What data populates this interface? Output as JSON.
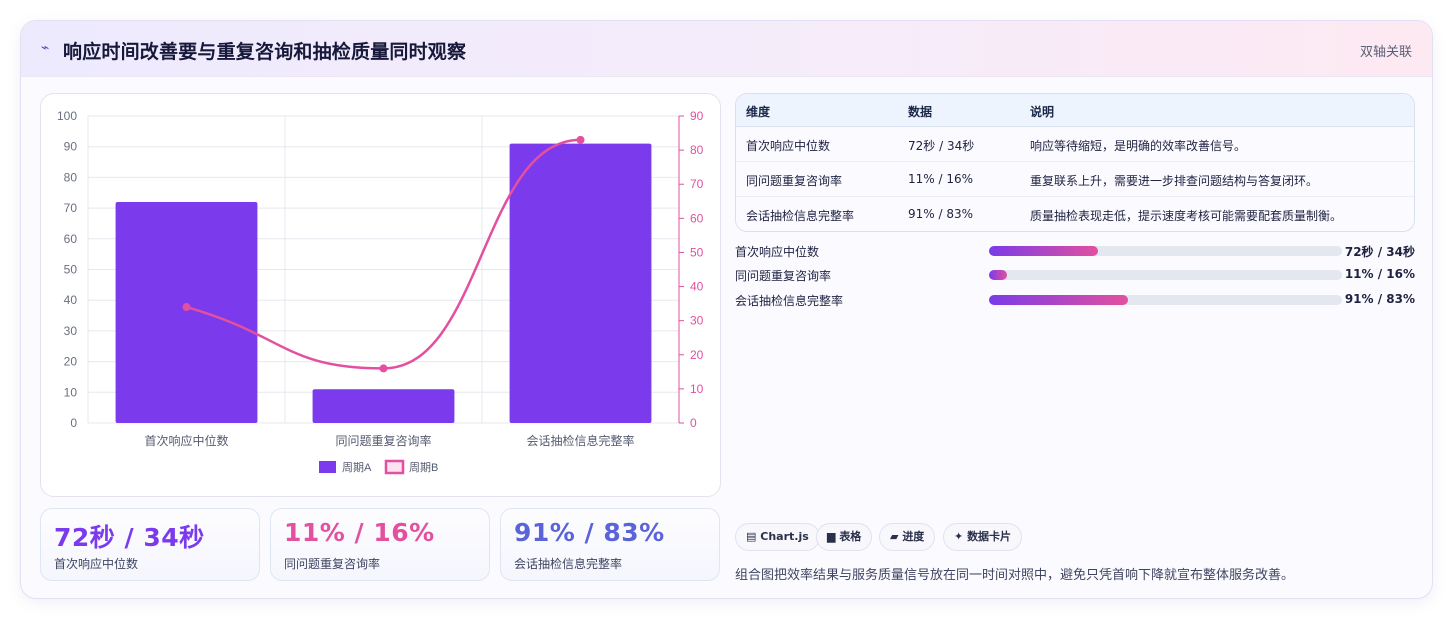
{
  "header": {
    "icon": "lightning-icon",
    "title": "响应时间改善要与重复咨询和抽检质量同时观察",
    "tag": "双轴关联"
  },
  "chart_data": {
    "type": "bar",
    "categories": [
      "首次响应中位数",
      "同问题重复咨询率",
      "会话抽检信息完整率"
    ],
    "series": [
      {
        "name": "周期A",
        "type": "bar",
        "axis": "left",
        "values": [
          72,
          11,
          91
        ],
        "color": "#7b3aeb"
      },
      {
        "name": "周期B",
        "type": "line",
        "axis": "right",
        "values": [
          34,
          16,
          83
        ],
        "color": "#e2509f"
      }
    ],
    "y_left": {
      "min": 0,
      "max": 100,
      "ticks": [
        0,
        10,
        20,
        30,
        40,
        50,
        60,
        70,
        80,
        90,
        100
      ]
    },
    "y_right": {
      "min": 0,
      "max": 90,
      "ticks": [
        0,
        10,
        20,
        30,
        40,
        50,
        60,
        70,
        80,
        90
      ]
    },
    "grid": true,
    "legend_position": "bottom"
  },
  "stats": [
    {
      "value": "72秒 / 34秒",
      "label": "首次响应中位数",
      "color": "#7b3aeb"
    },
    {
      "value": "11% / 16%",
      "label": "同问题重复咨询率",
      "color": "#e2509f"
    },
    {
      "value": "91% / 83%",
      "label": "会话抽检信息完整率",
      "color": "#5b63d8"
    }
  ],
  "table": {
    "headers": [
      "维度",
      "数据",
      "说明"
    ],
    "rows": [
      [
        "首次响应中位数",
        "72秒 / 34秒",
        "响应等待缩短，是明确的效率改善信号。"
      ],
      [
        "同问题重复咨询率",
        "11% / 16%",
        "重复联系上升，需要进一步排查问题结构与答复闭环。"
      ],
      [
        "会话抽检信息完整率",
        "91% / 83%",
        "质量抽检表现走低，提示速度考核可能需要配套质量制衡。"
      ]
    ]
  },
  "progress": [
    {
      "label": "首次响应中位数",
      "value": "72秒 / 34秒",
      "fraction": 0.31
    },
    {
      "label": "同问题重复咨询率",
      "value": "11% / 16%",
      "fraction": 0.05
    },
    {
      "label": "会话抽检信息完整率",
      "value": "91% / 83%",
      "fraction": 0.395
    }
  ],
  "chips": [
    {
      "icon": "chart-icon",
      "glyph": "▤",
      "label": "Chart.js"
    },
    {
      "icon": "table-icon",
      "glyph": "▆",
      "label": "表格"
    },
    {
      "icon": "progress-icon",
      "glyph": "▰",
      "label": "进度"
    },
    {
      "icon": "sparkle-icon",
      "glyph": "✦",
      "label": "数据卡片"
    }
  ],
  "footnote": "组合图把效率结果与服务质量信号放在同一时间对照中，避免只凭首响下降就宣布整体服务改善。"
}
